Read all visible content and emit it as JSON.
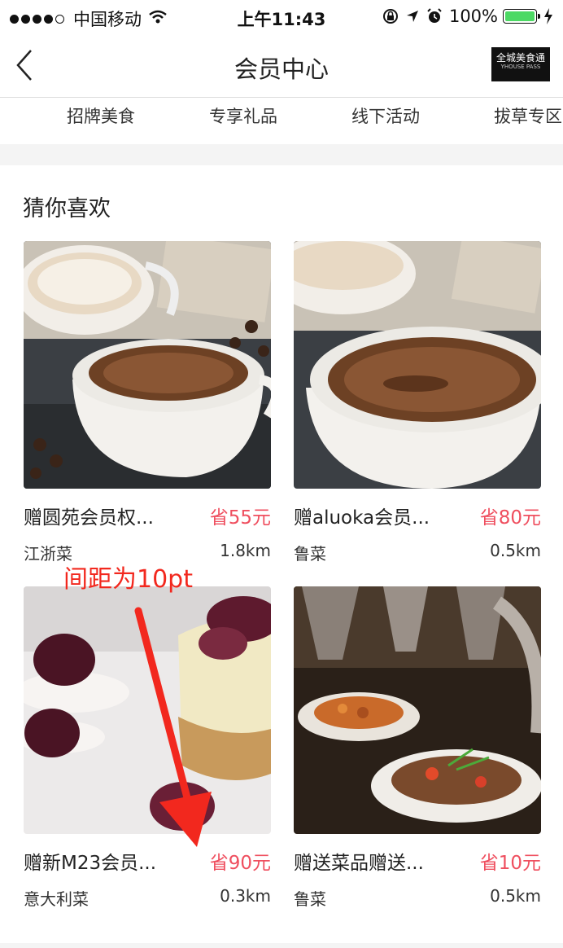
{
  "status_bar": {
    "carrier": "中国移动",
    "time": "上午11:43",
    "battery": "100%"
  },
  "nav": {
    "title": "会员中心",
    "brand_logo_text": "全城美食通",
    "brand_logo_sub": "YHOUSE PASS"
  },
  "tabs": [
    "招牌美食",
    "专享礼品",
    "线下活动",
    "拔草专区"
  ],
  "section_title": "猜你喜欢",
  "cards": [
    {
      "name": "赠圆苑会员权...",
      "save": "省55元",
      "cuisine": "江浙菜",
      "distance": "1.8km",
      "image": "coffee-cups-photo"
    },
    {
      "name": "赠aluoka会员...",
      "save": "省80元",
      "cuisine": "鲁菜",
      "distance": "0.5km",
      "image": "coffee-cup-closeup-photo"
    },
    {
      "name": "赠新M23会员...",
      "save": "省90元",
      "cuisine": "意大利菜",
      "distance": "0.3km",
      "image": "cheesecake-photo"
    },
    {
      "name": "赠送菜品赠送...",
      "save": "省10元",
      "cuisine": "鲁菜",
      "distance": "0.5km",
      "image": "buffet-dishes-photo"
    }
  ],
  "annotation": "间距为10pt",
  "colors": {
    "accent_price": "#ef4f5f",
    "annotation_red": "#f2281e",
    "battery_green": "#4cd964"
  }
}
